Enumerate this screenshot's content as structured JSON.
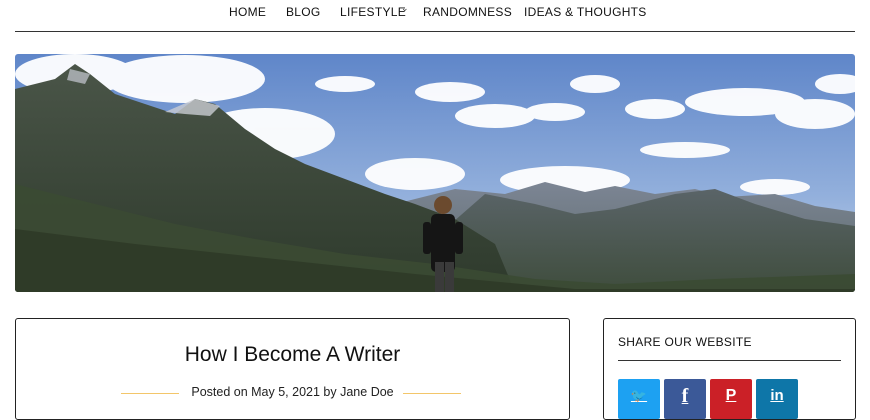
{
  "nav": {
    "items": [
      {
        "label": "HOME"
      },
      {
        "label": "BLOG"
      },
      {
        "label": "LIFESTYLE"
      },
      {
        "label": "RANDOMNESS"
      },
      {
        "label": "IDEAS & THOUGHTS"
      }
    ]
  },
  "hero": {
    "icon": "mountain-landscape-photo"
  },
  "post": {
    "title": "How I Become A Writer",
    "meta_prefix": "Posted on",
    "date": "May 5, 2021",
    "meta_by": "by",
    "author": "Jane Doe",
    "accent_color": "#f3c66a"
  },
  "sidebar": {
    "share_title": "SHARE OUR WEBSITE",
    "buttons": [
      {
        "network": "twitter",
        "icon": "twitter-icon",
        "glyph": "🐦",
        "color": "#1da1f2"
      },
      {
        "network": "facebook",
        "icon": "facebook-icon",
        "glyph": "f",
        "color": "#3b5998"
      },
      {
        "network": "pinterest",
        "icon": "pinterest-icon",
        "glyph": "P",
        "color": "#cb2027"
      },
      {
        "network": "linkedin",
        "icon": "linkedin-icon",
        "glyph": "in",
        "color": "#0e76a8"
      }
    ]
  }
}
